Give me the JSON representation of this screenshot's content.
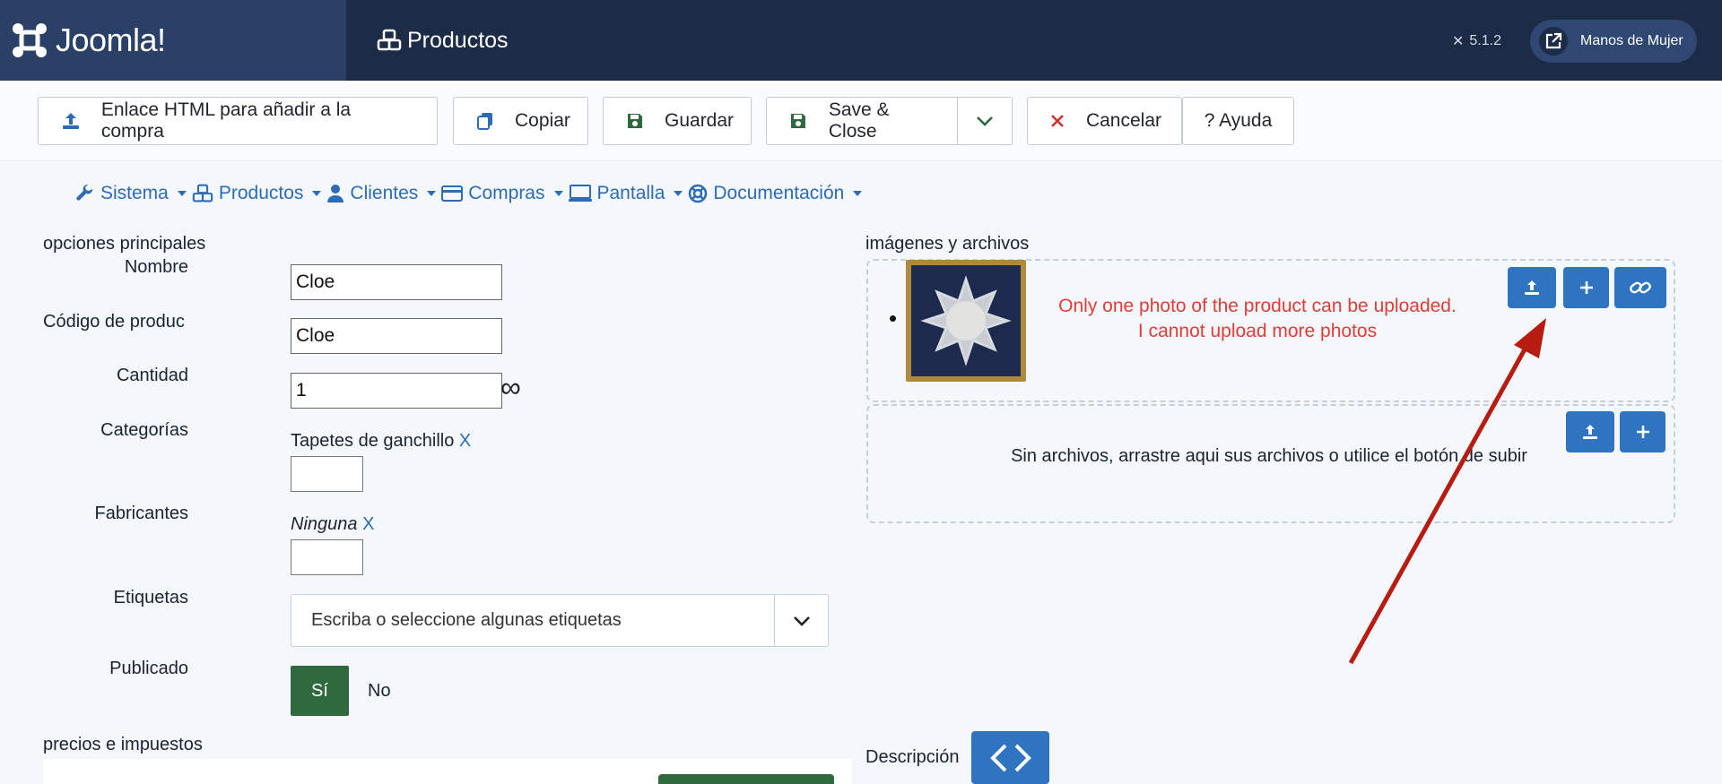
{
  "header": {
    "brand": "Joomla!",
    "page_title": "Productos",
    "version": "5.1.2",
    "site_button": "Manos de Mujer"
  },
  "toolbar": {
    "html_link_label": "Enlace HTML para añadir a la compra",
    "copy_label": "Copiar",
    "save_label": "Guardar",
    "save_close_label": "Save & Close",
    "cancel_label": "Cancelar",
    "help_label": "? Ayuda"
  },
  "nav": {
    "items": [
      "Sistema",
      "Productos",
      "Clientes",
      "Compras",
      "Pantalla",
      "Documentación"
    ]
  },
  "main_options": {
    "section_title": "opciones principales",
    "name_label": "Nombre",
    "name_value": "Cloe",
    "code_label": "Código de produc",
    "code_value": "Cloe",
    "quantity_label": "Cantidad",
    "quantity_value": "1",
    "infinity_symbol": "∞",
    "categories_label": "Categorías",
    "category_value": "Tapetes de ganchillo",
    "manufacturers_label": "Fabricantes",
    "manufacturer_value": "Ninguna",
    "remove_x": "X",
    "tags_label": "Etiquetas",
    "tags_placeholder": "Escriba o seleccione algunas etiquetas",
    "published_label": "Publicado",
    "published_yes": "Sí",
    "published_no": "No"
  },
  "prices": {
    "section_title": "precios e impuestos"
  },
  "media": {
    "section_title": "imágenes y archivos",
    "annotation_line1": "Only one photo of the product can be uploaded.",
    "annotation_line2": "I cannot upload more photos",
    "no_files_text": "Sin archivos, arrastre aqui sus archivos o utilice el botón de subir",
    "description_label": "Descripción"
  },
  "colors": {
    "header_bg": "#1c2b46",
    "accent_blue": "#2e74c0",
    "green": "#2e6a3d",
    "annotation_red": "#e33c34",
    "arrow_red": "#b81c10"
  }
}
